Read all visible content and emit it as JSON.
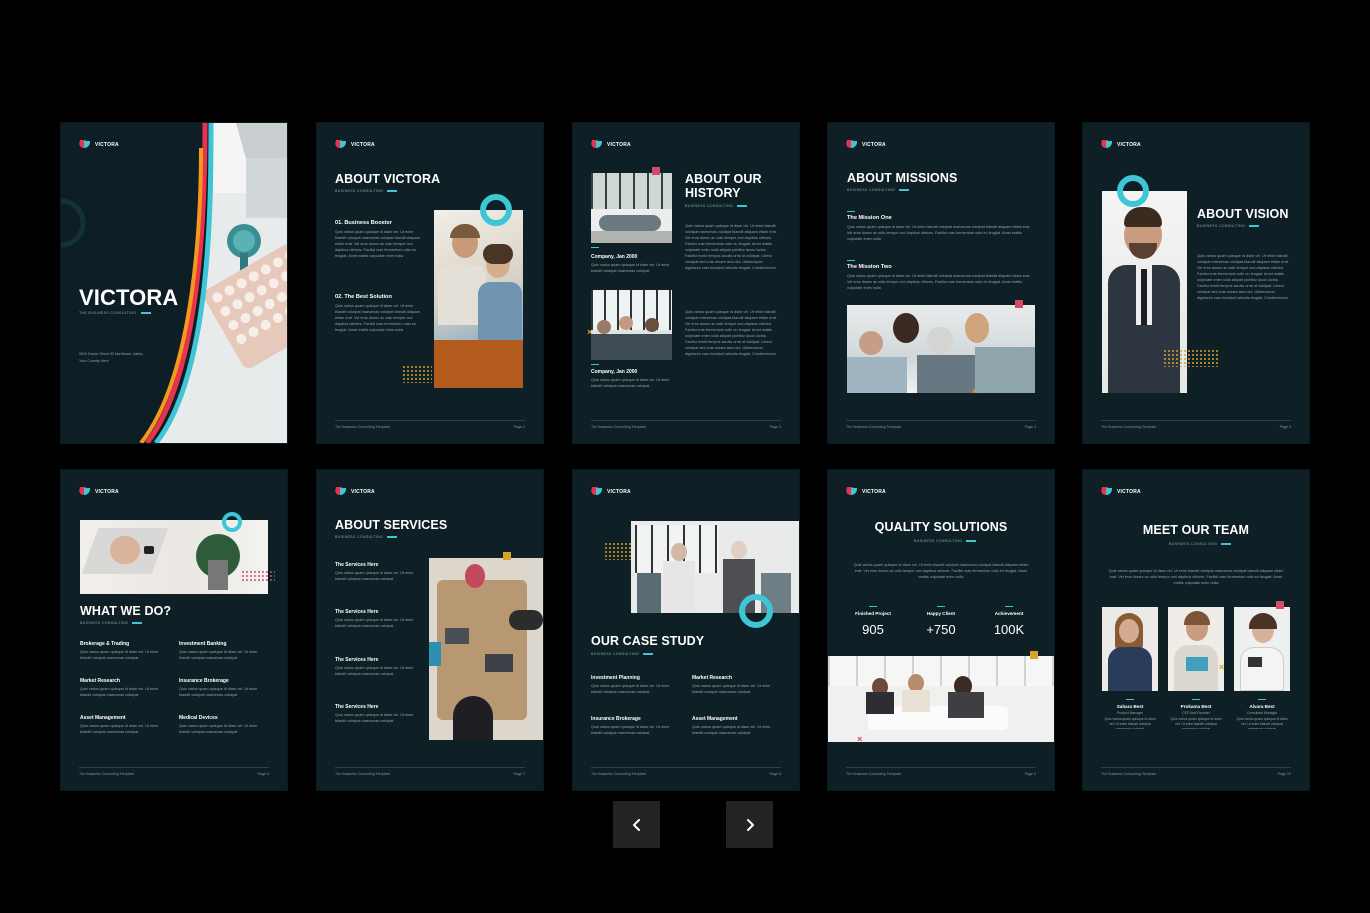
{
  "brand": {
    "logo_text": "VICTORA",
    "footer_text": "The Business Consulting Template"
  },
  "colors": {
    "background": "#000000",
    "page": "#0e2026",
    "accent_teal": "#3ec6d6",
    "accent_red": "#e8334f",
    "accent_yellow": "#d8a12a",
    "accent_orange": "#f39a1e"
  },
  "lorem": {
    "para": "Quis varius quam quisque id diam vel. Ut enim blandit volutpat maecenas volutpat blandit aliquam etiam erat. Vel eros donec ac odio tempor orci dapibus ultrices. Facilisi cras fermentum odio eu feugiat. Amet mattis vulputate enim nulla",
    "short": "Quis varius quam quisque id diam vel. Ut enim blandit volutpat maecenas volutpat",
    "long": "Quis varius quam quisque id diam vel. Ut enim blandit volutpat maecenas volutpat blandit aliquam etiam erat. Vel eros donec ac odio tempor orci dapibus ultrices. Facilisi cras fermentum odio eu feugiat. Amet mattis vulputate enim nulla aliquet porttitor lacus luctus. Facilisi morbi tempus iaculis urna id volutpat. Libero volutpat sed cras ornare arcu dui. Ullamcorper dignissim cras tincidunt lobortis feugiat. Condimentum"
  },
  "cover": {
    "title": "VICTORA",
    "subtitle": "THE BUSINESS CONSULTING",
    "address": "9924 Dance Street 92 Northtown, Astria, Your Country Here"
  },
  "about_victora": {
    "title": "ABOUT VICTORA",
    "subtitle": "BUSINESS CONSULTING",
    "h1": "01. Business Booster",
    "h2": "02. The Best Solution",
    "page": "Page 2"
  },
  "about_history": {
    "title": "ABOUT OUR HISTORY",
    "subtitle": "BUSINESS CONSULTING",
    "caption1": "Company, Jan 2000",
    "caption2": "Company, Jan 2000",
    "page": "Page 3"
  },
  "about_missions": {
    "title": "ABOUT MISSIONS",
    "subtitle": "BUSINESS CONSULTING",
    "h1": "The Mission One",
    "h2": "The Mission Two",
    "page": "Page 4"
  },
  "about_vision": {
    "title": "ABOUT VISION",
    "subtitle": "BUSINESS CONSULTING",
    "page": "Page 5"
  },
  "what_we_do": {
    "title": "WHAT WE DO?",
    "subtitle": "BUSINESS CONSULTING",
    "page": "Page 6",
    "items": [
      "Brokerage & Trading",
      "Investment Banking",
      "Market Research",
      "Insurance Brokerage",
      "Asset Management",
      "Medical Devices"
    ]
  },
  "about_services": {
    "title": "ABOUT SERVICES",
    "subtitle": "BUSINESS CONSULTING",
    "page": "Page 7",
    "items": [
      "The Services Here",
      "The Services Here",
      "The Services Here",
      "The Services Here"
    ]
  },
  "case_study": {
    "title": "OUR CASE STUDY",
    "subtitle": "BUSINESS CONSULTING",
    "page": "Page 8",
    "items": [
      "Investment Planning",
      "Market Research",
      "Insurance Brokerage",
      "Asset Management"
    ]
  },
  "quality": {
    "title": "QUALITY SOLUTIONS",
    "subtitle": "BUSINESS CONSULTING",
    "page": "Page 9",
    "stats": [
      {
        "label": "Finished Project",
        "value": "905"
      },
      {
        "label": "Happy Client",
        "value": "+750"
      },
      {
        "label": "Achievement",
        "value": "100K"
      }
    ]
  },
  "team": {
    "title": "MEET OUR TEAM",
    "subtitle": "BUSINESS CONSULTING",
    "page": "Page 10",
    "members": [
      {
        "name": "Sahara Best",
        "role": "Product Manager"
      },
      {
        "name": "Prokama Best",
        "role": "CEO And Founder"
      },
      {
        "name": "Alvara Best",
        "role": "Consultant Manager"
      }
    ]
  },
  "nav": {
    "prev_icon": "chevron-left-icon",
    "next_icon": "chevron-right-icon"
  }
}
